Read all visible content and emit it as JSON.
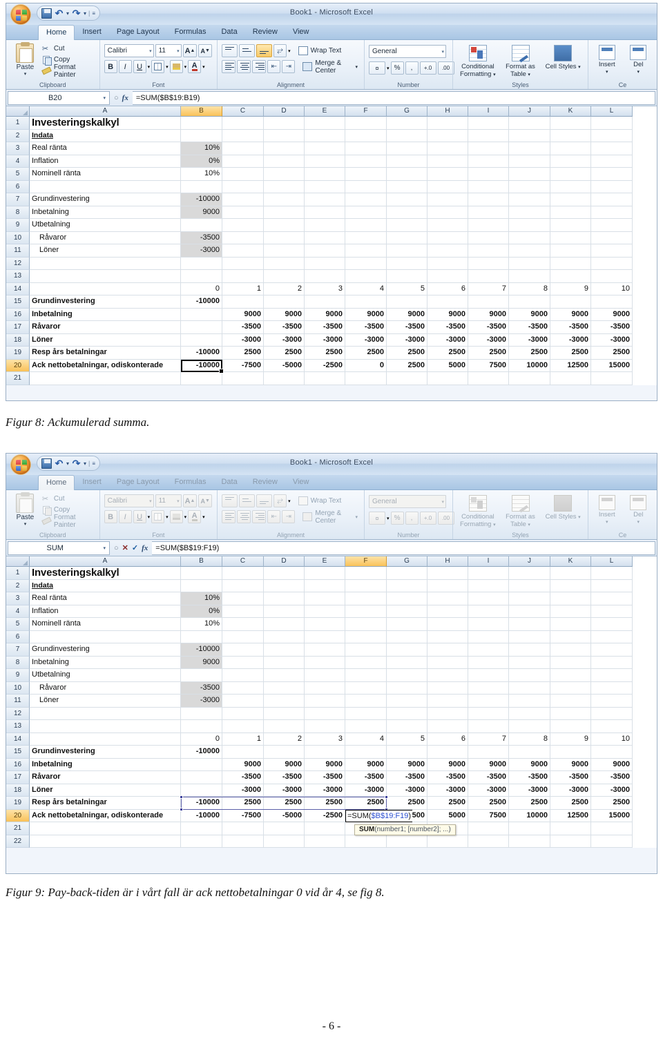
{
  "document": {
    "page_number": "- 6 -",
    "figure8_caption": "Figur 8: Ackumulerad summa.",
    "figure9_caption": "Figur 9: Pay-back-tiden är i vårt fall är ack nettobetalningar 0 vid år 4, se fig 8."
  },
  "excel": {
    "window_title": "Book1 - Microsoft Excel",
    "quick_access": [
      "save-icon",
      "undo-icon",
      "redo-icon",
      "customize-icon"
    ],
    "tabs": [
      "Home",
      "Insert",
      "Page Layout",
      "Formulas",
      "Data",
      "Review",
      "View"
    ],
    "active_tab": "Home",
    "ribbon": {
      "clipboard": {
        "name": "Clipboard",
        "paste": "Paste",
        "cut": "Cut",
        "copy": "Copy",
        "format_painter": "Format Painter"
      },
      "font": {
        "name": "Font",
        "font_family": "Calibri",
        "font_size": "11",
        "grow_font": "A",
        "shrink_font": "A",
        "bold": "B",
        "italic": "I",
        "underline": "U"
      },
      "alignment": {
        "name": "Alignment",
        "wrap_text": "Wrap Text",
        "merge_center": "Merge & Center"
      },
      "number": {
        "name": "Number",
        "format": "General",
        "percent": "%",
        "comma": ",",
        "increase_decimal": "+.0",
        "decrease_decimal": ".00"
      },
      "styles": {
        "name": "Styles",
        "conditional_formatting": "Conditional Formatting",
        "format_as_table": "Format as Table",
        "cell_styles": "Cell Styles"
      },
      "cells": {
        "name": "Ce",
        "insert": "Insert",
        "delete": "Del"
      }
    },
    "columns": [
      "A",
      "B",
      "C",
      "D",
      "E",
      "F",
      "G",
      "H",
      "I",
      "J",
      "K",
      "L"
    ],
    "shot1": {
      "name_box": "B20",
      "formula": "=SUM($B$19:B19)",
      "selected_column": "B",
      "selected_row": "20",
      "active_cell": "B20",
      "editing": false
    },
    "shot2": {
      "name_box": "SUM",
      "formula": "=SUM($B$19:F19)",
      "selected_column": "F",
      "selected_row": "20",
      "active_cell": "F20",
      "editing": true,
      "edit_text_prefix": "=SUM(",
      "edit_text_range": "$B$19:F19",
      "edit_text_suffix": ")",
      "tooltip_fn": "SUM",
      "tooltip_args": "(number1; [number2]; ...)",
      "marquee_range": "B19:F19",
      "cancel_icon": "cancel-icon",
      "accept_icon": "accept-icon",
      "fx_icon": "insert-function-icon"
    },
    "sheet": {
      "rows": [
        {
          "n": "1",
          "a": "Investeringskalkyl",
          "style": "title",
          "values": []
        },
        {
          "n": "2",
          "a": "Indata",
          "style": "ul",
          "values": []
        },
        {
          "n": "3",
          "a": "Real ränta",
          "style": "",
          "b": "10%",
          "b_shade": true,
          "values": []
        },
        {
          "n": "4",
          "a": "Inflation",
          "style": "",
          "b": "0%",
          "b_shade": true,
          "values": []
        },
        {
          "n": "5",
          "a": "Nominell ränta",
          "style": "",
          "b": "10%",
          "b_shade": false,
          "values": []
        },
        {
          "n": "6",
          "a": "",
          "style": "",
          "values": []
        },
        {
          "n": "7",
          "a": "Grundinvestering",
          "style": "",
          "b": "-10000",
          "b_shade": true,
          "values": []
        },
        {
          "n": "8",
          "a": "Inbetalning",
          "style": "",
          "b": "9000",
          "b_shade": true,
          "values": []
        },
        {
          "n": "9",
          "a": "Utbetalning",
          "style": "",
          "values": []
        },
        {
          "n": "10",
          "a": "Råvaror",
          "style": "ind",
          "b": "-3500",
          "b_shade": true,
          "values": []
        },
        {
          "n": "11",
          "a": "Löner",
          "style": "ind",
          "b": "-3000",
          "b_shade": true,
          "values": []
        },
        {
          "n": "12",
          "a": "",
          "style": "",
          "values": []
        },
        {
          "n": "13",
          "a": "",
          "style": "",
          "values": []
        },
        {
          "n": "14",
          "a": "",
          "style": "",
          "b": "0",
          "values": [
            "1",
            "2",
            "3",
            "4",
            "5",
            "6",
            "7",
            "8",
            "9",
            "10"
          ]
        },
        {
          "n": "15",
          "a": "Grundinvestering",
          "style": "b",
          "b": "-10000",
          "values": [
            "",
            "",
            "",
            "",
            "",
            "",
            "",
            "",
            "",
            ""
          ]
        },
        {
          "n": "16",
          "a": "Inbetalning",
          "style": "b",
          "b": "",
          "values": [
            "9000",
            "9000",
            "9000",
            "9000",
            "9000",
            "9000",
            "9000",
            "9000",
            "9000",
            "9000"
          ]
        },
        {
          "n": "17",
          "a": "Råvaror",
          "style": "b",
          "b": "",
          "values": [
            "-3500",
            "-3500",
            "-3500",
            "-3500",
            "-3500",
            "-3500",
            "-3500",
            "-3500",
            "-3500",
            "-3500"
          ]
        },
        {
          "n": "18",
          "a": "Löner",
          "style": "b",
          "b": "",
          "values": [
            "-3000",
            "-3000",
            "-3000",
            "-3000",
            "-3000",
            "-3000",
            "-3000",
            "-3000",
            "-3000",
            "-3000"
          ]
        },
        {
          "n": "19",
          "a": "Resp års betalningar",
          "style": "b",
          "b": "-10000",
          "values": [
            "2500",
            "2500",
            "2500",
            "2500",
            "2500",
            "2500",
            "2500",
            "2500",
            "2500",
            "2500"
          ]
        },
        {
          "n": "20",
          "a": "Ack nettobetalningar, odiskonterade",
          "style": "b",
          "b": "-10000",
          "values": [
            "-7500",
            "-5000",
            "-2500",
            "0",
            "2500",
            "5000",
            "7500",
            "10000",
            "12500",
            "15000"
          ]
        },
        {
          "n": "21",
          "a": "",
          "style": "",
          "values": []
        },
        {
          "n": "22",
          "a": "",
          "style": "",
          "values": []
        }
      ]
    }
  },
  "colors": {
    "selection_orange": "#f9c158",
    "shaded_cell": "#d9d9d9",
    "marquee_blue": "#5b5fa8",
    "formula_ref_blue": "#2b4fd0",
    "tooltip_bg": "#fefbe8"
  }
}
